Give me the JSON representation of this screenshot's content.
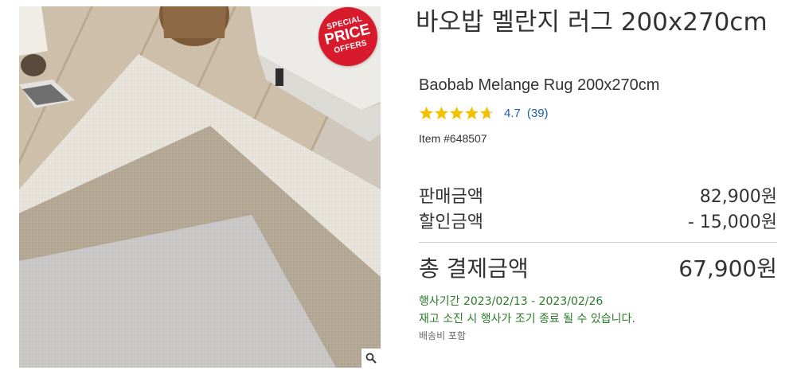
{
  "product": {
    "title_ko": "바오밥 멜란지 러그 200x270cm",
    "title_en": "Baobab Melange Rug 200x270cm",
    "rating_value": "4.7",
    "rating_score": 4.7,
    "rating_count": "(39)",
    "item_number": "Item #648507"
  },
  "badge": {
    "line1": "SPECIAL",
    "line2": "PRICE",
    "line3": "OFFERS",
    "color": "#d71b2c"
  },
  "pricing": {
    "sale_label": "판매금액",
    "sale_value": "82,900원",
    "discount_label": "할인금액",
    "discount_value": "- 15,000원",
    "total_label": "총 결제금액",
    "total_value": "67,900원"
  },
  "notes": {
    "promo_period": "행사기간 2023/02/13 - 2023/02/26",
    "stock_note": "재고 소진 시 행사가 조기 종료 될 수 있습니다.",
    "shipping": "배송비 포함"
  },
  "colors": {
    "star": "#f2c200",
    "link": "#1f5fa5",
    "promo_text": "#2a7a2a"
  },
  "icons": {
    "zoom": "magnifier-icon",
    "star": "star-icon"
  }
}
